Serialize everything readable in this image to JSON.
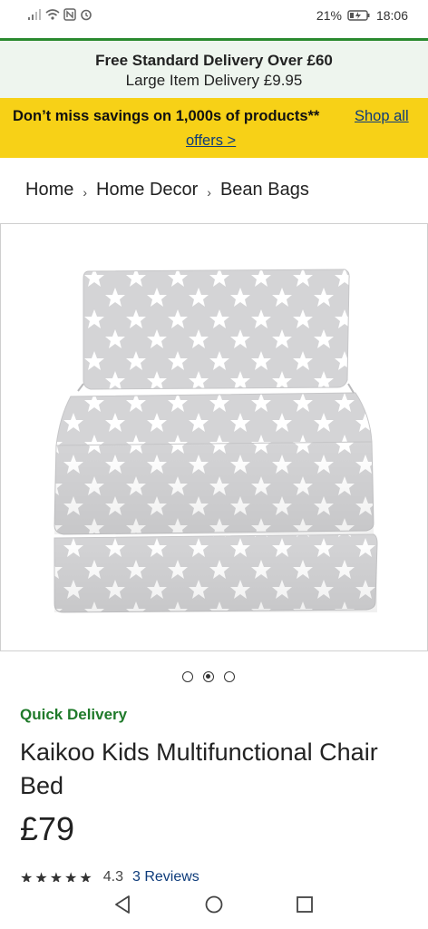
{
  "status_bar": {
    "battery": "21%",
    "time": "18:06",
    "icons": [
      "signal-icon",
      "wifi-icon",
      "nfc-icon",
      "alarm-icon",
      "battery-charging-icon"
    ]
  },
  "delivery_banner": {
    "line1": "Free Standard Delivery Over £60",
    "line2": "Large Item Delivery £9.95"
  },
  "promo_banner": {
    "message": "Don’t miss savings on 1,000s of products**",
    "link_part1": "Shop all",
    "link_part2": "offers >"
  },
  "breadcrumb": {
    "items": [
      "Home",
      "Home Decor",
      "Bean Bags"
    ]
  },
  "gallery": {
    "image_description_icon": "product-image",
    "dots_total": 3,
    "active_index": 1
  },
  "product": {
    "badge": "Quick Delivery",
    "name": "Kaikoo Kids Multifunctional Chair Bed",
    "price": "£79",
    "rating_value": "4.3",
    "reviews_label": "3 Reviews"
  },
  "nav_bar": {
    "icons": [
      "back-icon",
      "home-icon",
      "recents-icon"
    ]
  },
  "colors": {
    "accent_green": "#2a8a2e",
    "promo_yellow": "#f7d117",
    "link_blue": "#0d3b7a",
    "product_grey": "#d6d6d8"
  }
}
